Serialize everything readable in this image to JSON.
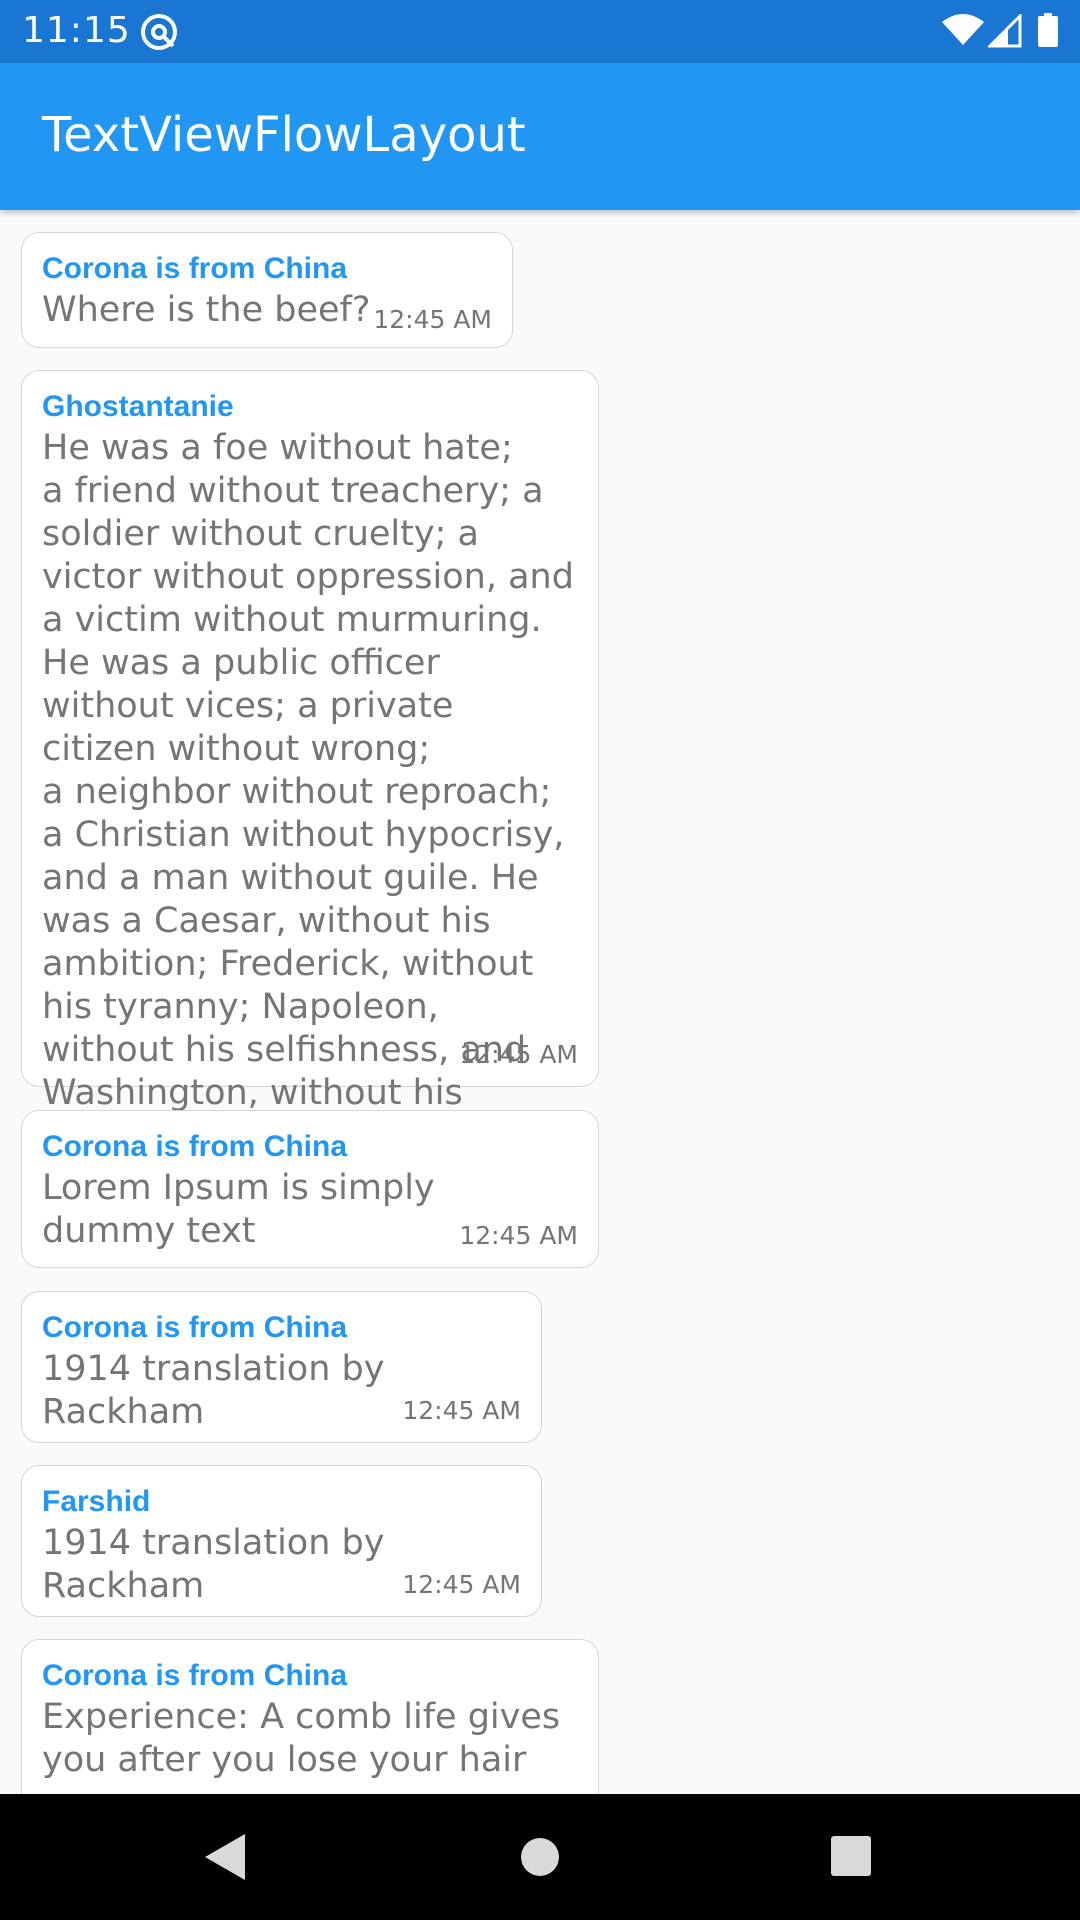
{
  "status_bar": {
    "time": "11:15",
    "icons": [
      "at-sign-icon",
      "wifi-icon",
      "cell-signal-icon",
      "battery-icon"
    ]
  },
  "app_bar": {
    "title": "TextViewFlowLayout",
    "color": "#2196f3",
    "status_color": "#1976d2"
  },
  "messages": [
    {
      "sender": "Corona is from China",
      "text": "Where is the beef?",
      "time": "12:45 AM"
    },
    {
      "sender": "Ghostantanie",
      "text": "He was a foe without hate;\na friend without treachery; a soldier without cruelty; a victor without oppression, and a victim without murmuring. He was a public officer without vices; a private citizen without wrong;\na neighbor without reproach;\na Christian without hypocrisy, and a man without guile. He was a Caesar, without his ambition; Frederick, without his tyranny; Napoleon, without his selfishness, and Washington, without his reward.",
      "time": "12:45 AM"
    },
    {
      "sender": "Corona is from China",
      "text": "Lorem Ipsum is simply dummy text",
      "time": "12:45 AM"
    },
    {
      "sender": "Corona is from China",
      "text": "1914 translation by Rackham",
      "time": "12:45 AM"
    },
    {
      "sender": "Farshid",
      "text": "1914 translation by Rackham",
      "time": "12:45 AM"
    },
    {
      "sender": "Corona is from China",
      "text": "Experience: A comb life gives you after you lose your hair",
      "time": ""
    }
  ],
  "nav_bar": {
    "icons": [
      "back-icon",
      "home-icon",
      "recents-icon"
    ]
  }
}
